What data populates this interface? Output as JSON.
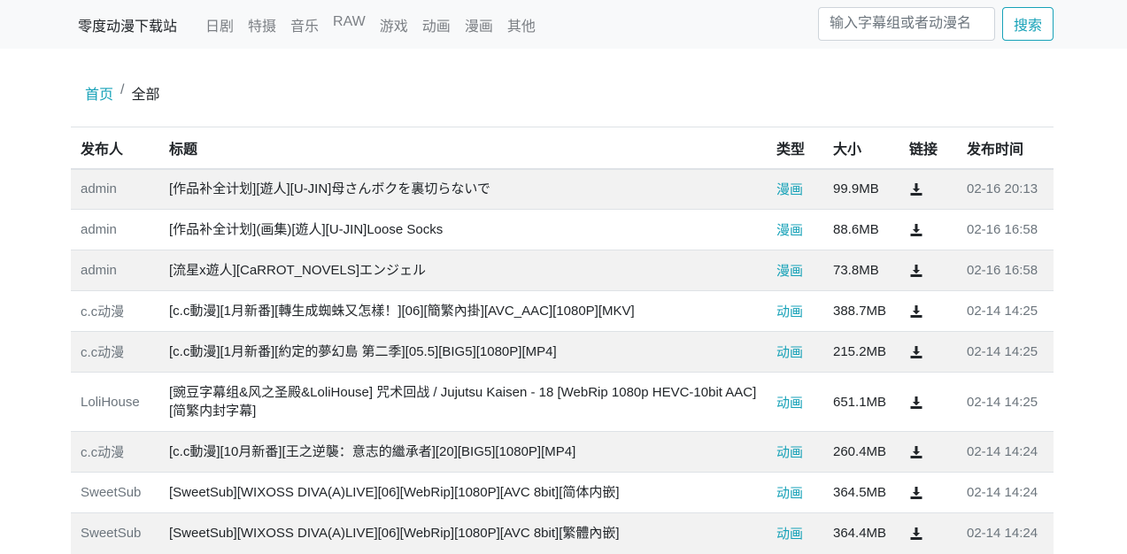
{
  "navbar": {
    "brand": "零度动漫下载站",
    "links": [
      "日剧",
      "特摄",
      "音乐",
      "RAW",
      "游戏",
      "动画",
      "漫画",
      "其他"
    ],
    "search_placeholder": "输入字幕组或者动漫名",
    "search_button": "搜索"
  },
  "breadcrumb": {
    "home": "首页",
    "separator": "/",
    "current": "全部"
  },
  "table": {
    "headers": [
      "发布人",
      "标题",
      "类型",
      "大小",
      "链接",
      "发布时间"
    ],
    "rows": [
      {
        "publisher": "admin",
        "title": "[作品补全计划][遊人][U-JIN]母さんボクを裏切らないで",
        "type": "漫画",
        "size": "99.9MB",
        "date": "02-16 20:13"
      },
      {
        "publisher": "admin",
        "title": "[作品补全计划](画集)[遊人][U-JIN]Loose Socks",
        "type": "漫画",
        "size": "88.6MB",
        "date": "02-16 16:58"
      },
      {
        "publisher": "admin",
        "title": "[流星x遊人][CaRROT_NOVELS]エンジェル",
        "type": "漫画",
        "size": "73.8MB",
        "date": "02-16 16:58"
      },
      {
        "publisher": "c.c动漫",
        "title": "[c.c動漫][1月新番][轉生成蜘蛛又怎樣！][06][簡繁內掛][AVC_AAC][1080P][MKV]",
        "type": "动画",
        "size": "388.7MB",
        "date": "02-14 14:25"
      },
      {
        "publisher": "c.c动漫",
        "title": "[c.c動漫][1月新番][約定的夢幻島 第二季][05.5][BIG5][1080P][MP4]",
        "type": "动画",
        "size": "215.2MB",
        "date": "02-14 14:25"
      },
      {
        "publisher": "LoliHouse",
        "title": "[豌豆字幕组&风之圣殿&LoliHouse] 咒术回战 / Jujutsu Kaisen - 18 [WebRip 1080p HEVC-10bit AAC][简繁内封字幕]",
        "type": "动画",
        "size": "651.1MB",
        "date": "02-14 14:25"
      },
      {
        "publisher": "c.c动漫",
        "title": "[c.c動漫][10月新番][王之逆襲：意志的繼承者][20][BIG5][1080P][MP4]",
        "type": "动画",
        "size": "260.4MB",
        "date": "02-14 14:24"
      },
      {
        "publisher": "SweetSub",
        "title": "[SweetSub][WIXOSS DIVA(A)LIVE][06][WebRip][1080P][AVC 8bit][简体内嵌]",
        "type": "动画",
        "size": "364.5MB",
        "date": "02-14 14:24"
      },
      {
        "publisher": "SweetSub",
        "title": "[SweetSub][WIXOSS DIVA(A)LIVE][06][WebRip][1080P][AVC 8bit][繁體內嵌]",
        "type": "动画",
        "size": "364.4MB",
        "date": "02-14 14:24"
      }
    ]
  },
  "colors": {
    "accent": "#17a2b8",
    "muted": "#6c757d",
    "stripe": "#f2f2f2",
    "navbar_bg": "#f8f9fa"
  },
  "icons": {
    "download": "download-icon"
  }
}
